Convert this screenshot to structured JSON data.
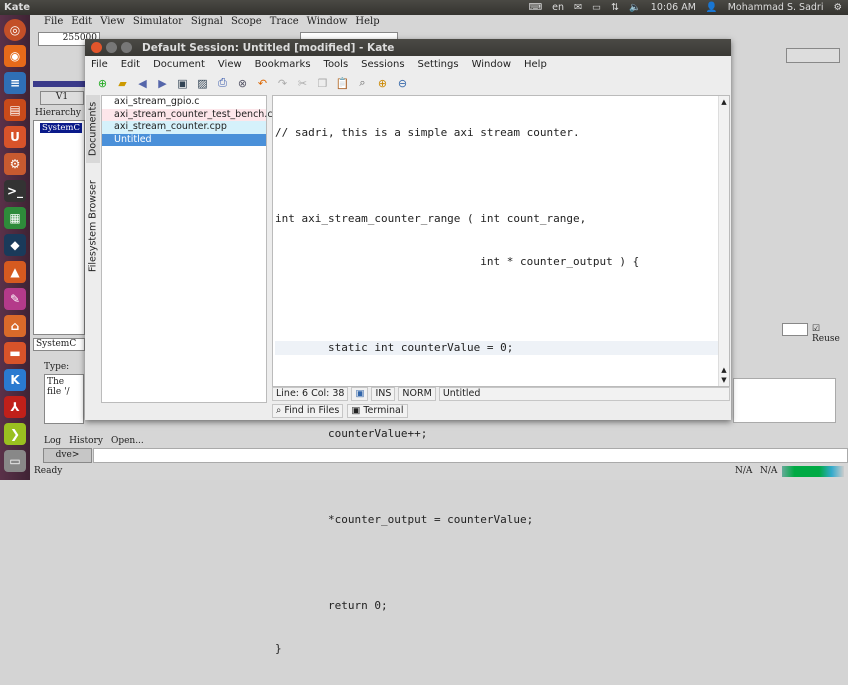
{
  "top_panel": {
    "app": "Kate",
    "lang": "en",
    "time": "10:06 AM",
    "user": "Mohammad S. Sadri"
  },
  "dve": {
    "menu": [
      "File",
      "Edit",
      "View",
      "Simulator",
      "Signal",
      "Scope",
      "Trace",
      "Window",
      "Help"
    ],
    "time_value": "255000",
    "view": "V1",
    "hierarchy_label": "Hierarchy",
    "hierarchy_item": "SystemC",
    "scope_field": "SystemC",
    "type_label": "Type:",
    "log_text": "The file '/",
    "tabs": [
      "Log",
      "History",
      "Open..."
    ],
    "prompt": "dve>",
    "status": "Ready",
    "reuse_label": "Reuse",
    "na1": "N/A",
    "na2": "N/A"
  },
  "kate": {
    "title": "Default Session: Untitled [modified] - Kate",
    "menu": [
      "File",
      "Edit",
      "Document",
      "View",
      "Bookmarks",
      "Tools",
      "Sessions",
      "Settings",
      "Window",
      "Help"
    ],
    "side_tabs": [
      "Documents",
      "Filesystem Browser"
    ],
    "documents": [
      {
        "name": "axi_stream_gpio.c",
        "bg": "#ffffff"
      },
      {
        "name": "axi_stream_counter_test_bench.cpp",
        "bg": "#fde6ea"
      },
      {
        "name": "axi_stream_counter.cpp",
        "bg": "#d5f1fb"
      },
      {
        "name": "Untitled",
        "bg": "#4a90d9"
      }
    ],
    "code": [
      "// sadri, this is a simple axi stream counter.",
      "",
      "int axi_stream_counter_range ( int count_range,",
      "                               int * counter_output ) {",
      "",
      "        static int counterValue = 0;",
      "",
      "        counterValue++;",
      "",
      "        *counter_output = counterValue;",
      "",
      "        return 0;",
      "}"
    ],
    "status": {
      "position": "Line: 6 Col: 38",
      "mode": "INS",
      "input": "NORM",
      "doc": "Untitled"
    },
    "bottom_tabs": [
      "Find in Files",
      "Terminal"
    ]
  }
}
